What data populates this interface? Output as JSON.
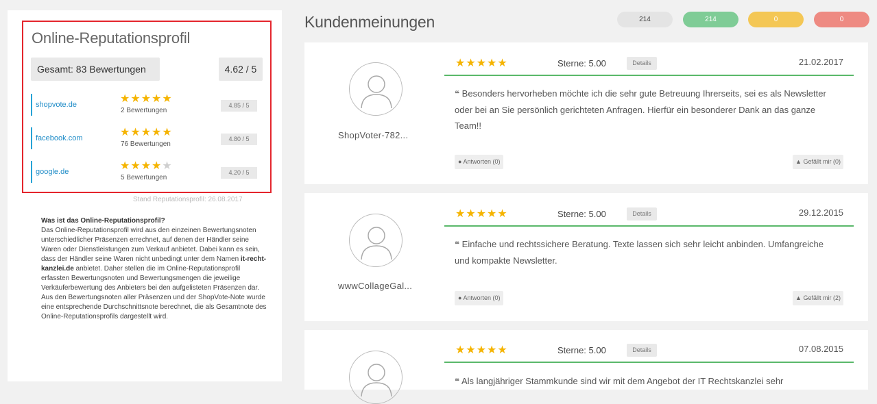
{
  "sidebar": {
    "title": "Online-Reputationsprofil",
    "total_label": "Gesamt: 83 Bewertungen",
    "total_score": "4.62 / 5",
    "sources": [
      {
        "name": "shopvote.de",
        "stars": 5,
        "count": "2 Bewertungen",
        "score": "4.85 / 5"
      },
      {
        "name": "facebook.com",
        "stars": 5,
        "count": "76 Bewertungen",
        "score": "4.80 / 5"
      },
      {
        "name": "google.de",
        "stars": 4,
        "count": "5 Bewertungen",
        "score": "4.20 / 5"
      }
    ],
    "stand": "Stand Reputationsprofil: 26.08.2017",
    "faq_title": "Was ist das Online-Reputationsprofil?",
    "faq_body_1": "Das Online-Reputationsprofil wird aus den einzeinen Bewertungsnoten unterschiedlicher Präsenzen errechnet, auf denen der Händler seine Waren oder Dienstleistungen zum Verkauf anbietet. Dabei kann es sein, dass der Händler seine Waren nicht unbedingt unter dem Namen ",
    "faq_body_bold": "it-recht-kanzlei.de",
    "faq_body_2": " anbietet. Daher stellen die im Online-Reputationsprofil erfassten Bewertungsnoten und Bewertungsmengen die jeweilige Verkäuferbewertung des Anbieters bei den aufgelisteten Präsenzen dar. Aus den Bewertungsnoten aller Präsenzen und der ShopVote-Note wurde eine entsprechende Durchschnittsnote berechnet, die als Gesamtnote des Online-Reputationsprofils dargestellt wird."
  },
  "main": {
    "title": "Kundenmeinungen",
    "pills": [
      "214",
      "214",
      "0",
      "0"
    ]
  },
  "reviews": [
    {
      "username": "ShopVoter-782...",
      "stars": 5,
      "sterne": "Sterne: 5.00",
      "details": "Details",
      "date": "21.02.2017",
      "quote_mark": "❝",
      "text": "Besonders hervorheben möchte ich die sehr gute Betreuung Ihrerseits, sei es als Newsletter oder bei an Sie persönlich gerichteten Anfragen. Hierfür ein besonderer Dank an das ganze Team!!",
      "reply": "Antworten (0)",
      "like": "Gefällt mir (0)"
    },
    {
      "username": "wwwCollageGal...",
      "stars": 5,
      "sterne": "Sterne: 5.00",
      "details": "Details",
      "date": "29.12.2015",
      "quote_mark": "❝",
      "text": "Einfache und rechtssichere Beratung. Texte lassen sich sehr leicht anbinden. Umfangreiche und kompakte Newsletter.",
      "reply": "Antworten (0)",
      "like": "Gefällt mir (2)"
    },
    {
      "username": "",
      "stars": 5,
      "sterne": "Sterne: 5.00",
      "details": "Details",
      "date": "07.08.2015",
      "quote_mark": "❝",
      "text": "Als langjähriger Stammkunde sind wir mit dem Angebot der IT Rechtskanzlei sehr",
      "reply": "",
      "like": ""
    }
  ],
  "colors": {
    "highlight_border": "#e4252d",
    "star": "#f5b400",
    "link": "#1d8bc7",
    "divider": "#5ab86a",
    "pill_green": "#7fcc96",
    "pill_yellow": "#f4c755",
    "pill_red": "#ee8a82"
  },
  "icons": {
    "quote": "quote-icon",
    "reply": "speech-bubble-icon",
    "like": "thumbs-up-icon",
    "avatar": "user-placeholder-icon"
  }
}
